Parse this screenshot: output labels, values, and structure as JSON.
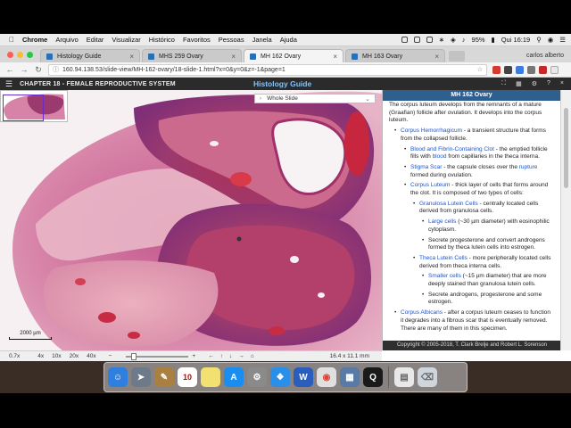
{
  "menubar": {
    "app": "Chrome",
    "items": [
      "Arquivo",
      "Editar",
      "Visualizar",
      "Histórico",
      "Favoritos",
      "Pessoas",
      "Janela",
      "Ajuda"
    ],
    "battery": "95%",
    "clock": "Qui 16:19"
  },
  "tabs": [
    {
      "label": "Histology Guide",
      "active": false
    },
    {
      "label": "MHS 259 Ovary",
      "active": false
    },
    {
      "label": "MH 162 Ovary",
      "active": true
    },
    {
      "label": "MH 163 Ovary",
      "active": false
    }
  ],
  "profile_name": "carlos alberto",
  "address": {
    "url": "160.94.138.53/slide-view/MH-162-ovary/18-slide-1.html?x=0&y=0&z=-1&page=1"
  },
  "site": {
    "chapter": "CHAPTER 18 - FEMALE REPRODUCTIVE SYSTEM",
    "title": "Histology Guide"
  },
  "viewer": {
    "region_select": "Whole Slide",
    "scale_label": "2000 µm",
    "zoom": "0.7x",
    "magnifications": [
      "4x",
      "10x",
      "20x",
      "40x"
    ],
    "dimensions": "16.4 x 11.1 mm"
  },
  "pane": {
    "header": "MH 162 Ovary",
    "intro": "The corpus luteum develops from the remnants of a mature (Graafian) follicle after ovulation. It develops into the corpus luteum.",
    "b1_term": "Corpus Hemorrhagicum",
    "b1_text": " - a transient structure that forms from the collapsed follicle.",
    "b1a_term": "Blood and Fibrin-Containing Clot",
    "b1a_text": " - the emptied follicle fills with ",
    "b1a_link": "blood",
    "b1a_text2": " from capillaries in the theca interna.",
    "b1b_term": "Stigma Scar",
    "b1b_text": " - the capsule closes over the ",
    "b1b_link": "rupture",
    "b1b_text2": " formed during ovulation.",
    "b1c_term": "Corpus Luteum",
    "b1c_text": " - thick layer of cells that forms around the clot. It is composed of two types of cells:",
    "g_term": "Granulosa Lutein Cells",
    "g_text": " - centrally located cells derived from granulosa cells.",
    "g1_term": "Large cells",
    "g1_text": " (~30 µm diameter) with eosinophilic cytoplasm.",
    "g2_text": "Secrete progesterone and convert androgens formed by theca lutein cells into estrogen.",
    "t_term": "Theca Lutein Cells",
    "t_text": " - more peripherally located cells derived from theca interna cells.",
    "t1_term": "Smaller cells",
    "t1_text": " (~15 µm diameter) that are more deeply stained than granulosa lutein cells.",
    "t2_text": "Secrete androgens, progesterone and some estrogen.",
    "b2_term": "Corpus Albicans",
    "b2_text": " - after a corpus luteum ceases to function it degrades into a fibrous scar that is eventually removed. There are many of them in this specimen.",
    "footer": "Copyright © 2005-2018, T. Clark Brelje and Robert L. Sorenson"
  },
  "dock": {
    "calendar_day": "10"
  },
  "colors": {
    "site_title": "#7fc3ff",
    "pane_header": "#2f5f8e",
    "link": "#1f54c7"
  }
}
